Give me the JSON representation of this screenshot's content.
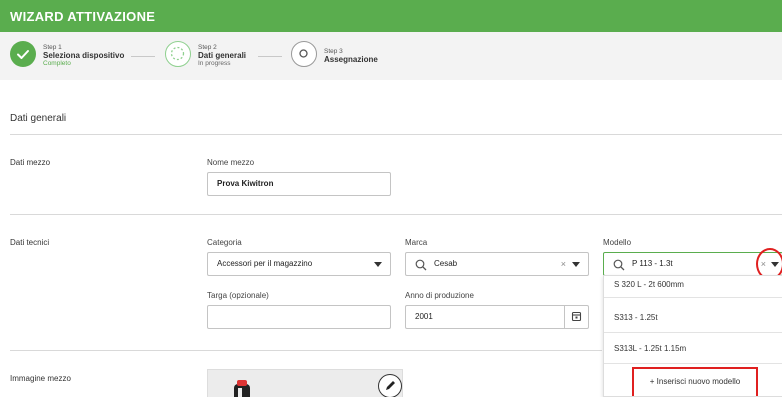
{
  "header": {
    "title": "WIZARD ATTIVAZIONE"
  },
  "steps": [
    {
      "number": "Step 1",
      "title": "Seleziona dispositivo",
      "status": "Completo"
    },
    {
      "number": "Step 2",
      "title": "Dati generali",
      "status": "In progress"
    },
    {
      "number": "Step 3",
      "title": "Assegnazione",
      "status": ""
    }
  ],
  "section": {
    "title": "Dati generali"
  },
  "dati_mezzo": {
    "label": "Dati mezzo",
    "nome_label": "Nome mezzo",
    "nome_value": "Prova Kiwitron"
  },
  "dati_tecnici": {
    "label": "Dati tecnici",
    "categoria_label": "Categoria",
    "categoria_value": "Accessori per il magazzino",
    "marca_label": "Marca",
    "marca_value": "Cesab",
    "modello_label": "Modello",
    "modello_value": "P 113 - 1.3t",
    "targa_label": "Targa (opzionale)",
    "targa_value": "",
    "anno_label": "Anno di produzione",
    "anno_value": "2001"
  },
  "modello_dropdown": {
    "options": [
      "S 320 L - 2t 600mm",
      "S313 - 1.25t",
      "S313L - 1.25t 1.15m"
    ],
    "add_label": "+ Inserisci nuovo modello"
  },
  "immagine": {
    "label": "Immagine mezzo"
  },
  "clear_symbol": "×",
  "colors": {
    "brand": "#5aad4e",
    "highlight": "#e02020"
  }
}
